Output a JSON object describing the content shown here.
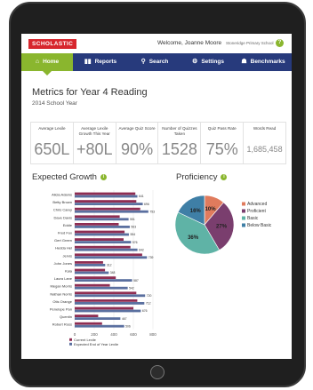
{
  "topbar": {
    "logo": "SCHOLASTIC",
    "welcome": "Welcome, Joanne Moore",
    "school": "Stoneridge Primary School",
    "help_icon": "help-icon"
  },
  "nav": {
    "items": [
      {
        "label": "Home",
        "icon": "⌂",
        "icon_name": "home-icon",
        "active": true
      },
      {
        "label": "Reports",
        "icon": "▮▮",
        "icon_name": "bar-chart-icon",
        "active": false
      },
      {
        "label": "Search",
        "icon": "⚲",
        "icon_name": "search-icon",
        "active": false
      },
      {
        "label": "Settings",
        "icon": "⚙",
        "icon_name": "gear-icon",
        "active": false
      },
      {
        "label": "Benchmarks",
        "icon": "☗",
        "icon_name": "person-icon",
        "active": false
      }
    ]
  },
  "page": {
    "title": "Metrics for Year 4 Reading",
    "subtitle": "2014 School Year"
  },
  "metrics": [
    {
      "label": "Average Lexile",
      "value": "650L"
    },
    {
      "label": "Average Lexile Growth This Year",
      "value": "+80L"
    },
    {
      "label": "Average Quiz Score",
      "value": "90%"
    },
    {
      "label": "Number of Quizzes Taken",
      "value": "1528"
    },
    {
      "label": "Quiz Pass Rate",
      "value": "75%"
    },
    {
      "label": "Words Read",
      "value": "1,685,458"
    }
  ],
  "growth": {
    "title": "Expected Growth",
    "legend": [
      "Current Lexile",
      "Expected End of Year Lexile"
    ]
  },
  "proficiency": {
    "title": "Proficiency"
  },
  "colors": {
    "nav_bg": "#273a7c",
    "accent_green": "#8ab62e",
    "logo_red": "#d7262d",
    "bar_current": "#8f2d52",
    "bar_expected": "#5a6f9f",
    "pie_advanced": "#e07b5d",
    "pie_proficient": "#7a3e6e",
    "pie_basic": "#5fb3a6",
    "pie_below": "#3f7fa6"
  },
  "chart_data": [
    {
      "type": "bar",
      "title": "Expected Growth",
      "orientation": "horizontal",
      "categories": [
        "Alicia Adams",
        "Betty Brown",
        "Chris Carey",
        "Dave Davis",
        "Eddie",
        "Fred Fox",
        "Gert Green",
        "Hedda Hel",
        "Jervis",
        "John Jones",
        "Kaia",
        "Laura Lane",
        "Megan Morris",
        "Nathan Norris",
        "Otis Orange",
        "Penelope Pan",
        "Quentin",
        "Robert Ross"
      ],
      "x_ticks": [
        "0",
        "200",
        "400",
        "600",
        "800"
      ],
      "xlim": [
        0,
        800
      ],
      "series": [
        {
          "name": "Current Lexile",
          "values": [
            620,
            630,
            670,
            460,
            450,
            510,
            500,
            570,
            690,
            290,
            310,
            420,
            360,
            630,
            640,
            600,
            240,
            280
          ]
        },
        {
          "name": "Expected End of Year Lexile",
          "values": [
            641,
            696,
            753,
            551,
            563,
            554,
            576,
            642,
            739,
            312,
            348,
            587,
            542,
            720,
            712,
            676,
            467,
            506
          ]
        }
      ],
      "data_labels": [
        "641",
        "696",
        "753",
        "551",
        "563",
        "554",
        "576",
        "642",
        "739",
        "312",
        "348",
        "587",
        "542",
        "720",
        "712",
        "676",
        "467",
        "506"
      ]
    },
    {
      "type": "pie",
      "title": "Proficiency",
      "labels": [
        "Advanced",
        "Proficient",
        "Basic",
        "Below Basic"
      ],
      "values": [
        10,
        27,
        36,
        16
      ],
      "slice_labels": [
        "10%",
        "27%",
        "36%",
        "16%"
      ]
    }
  ]
}
